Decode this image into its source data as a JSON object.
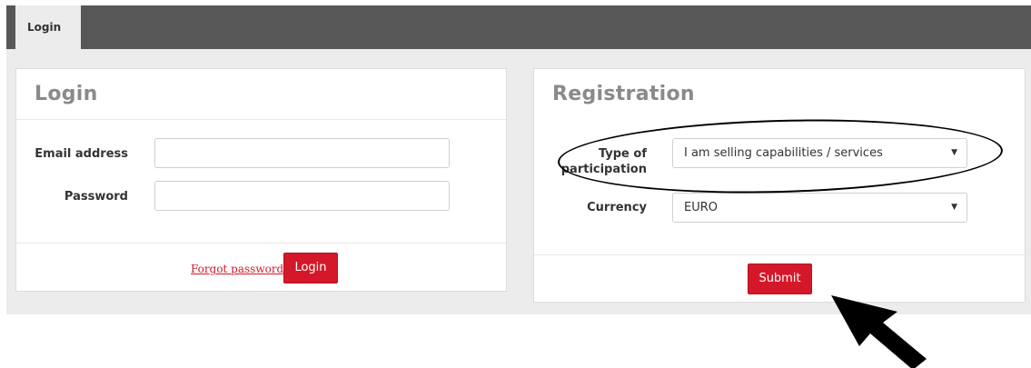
{
  "nav": {
    "tab_login": "Login"
  },
  "login": {
    "title": "Login",
    "email_label": "Email address",
    "email_value": "",
    "password_label": "Password",
    "password_value": "",
    "forgot_link": "Forgot password",
    "login_button": "Login"
  },
  "registration": {
    "title": "Registration",
    "participation_label_line1": "Type of",
    "participation_label_line2": "participation",
    "participation_value": "I am selling capabilities / services",
    "currency_label": "Currency",
    "currency_value": "EURO",
    "submit_button": "Submit"
  },
  "colors": {
    "accent": "#d4182a",
    "topbar": "#575757",
    "panel_title": "#8a8a8a"
  },
  "icons": {
    "select_caret": "caret-down-icon",
    "annotation_arrow": "arrow-icon"
  }
}
